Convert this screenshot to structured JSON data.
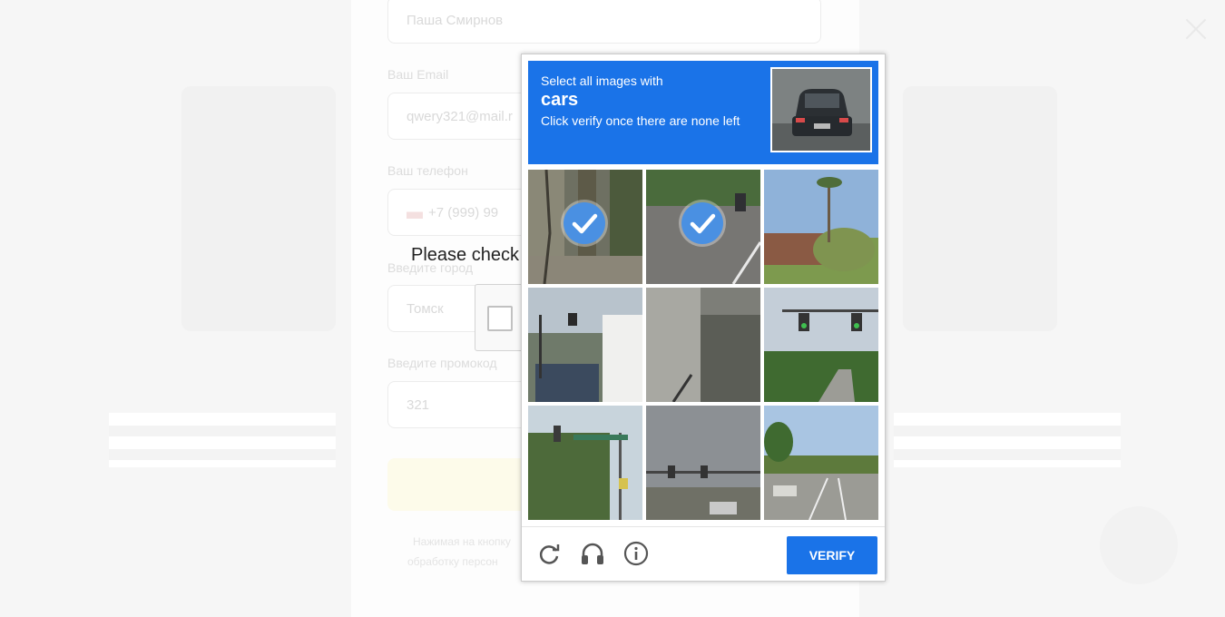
{
  "background_form": {
    "name_value": "Паша Смирнов",
    "email_label": "Ваш Email",
    "email_value": "qwery321@mail.r",
    "phone_label": "Ваш телефон",
    "phone_value": "+7 (999) 99",
    "city_label": "Введите город",
    "city_value": "Томск",
    "promo_label": "Введите промокод",
    "promo_value": "321",
    "note_line1": "Нажимая на кнопку",
    "note_line2": "обработку персон"
  },
  "recaptcha_anchor": {
    "prompt": "Please check"
  },
  "challenge": {
    "instruction_line1": "Select all images with",
    "target_word": "cars",
    "instruction_line3": "Click verify once there are none left",
    "tiles": [
      {
        "label": "tile-1",
        "selected": true
      },
      {
        "label": "tile-2",
        "selected": true
      },
      {
        "label": "tile-3",
        "selected": false
      },
      {
        "label": "tile-4",
        "selected": false
      },
      {
        "label": "tile-5",
        "selected": false
      },
      {
        "label": "tile-6",
        "selected": false
      },
      {
        "label": "tile-7",
        "selected": false
      },
      {
        "label": "tile-8",
        "selected": false
      },
      {
        "label": "tile-9",
        "selected": false
      }
    ],
    "footer_icons": [
      "reload-icon",
      "headphones-icon",
      "info-icon"
    ],
    "verify_label": "VERIFY"
  },
  "colors": {
    "header_blue": "#1a73e8",
    "check_blue": "#4a90e2"
  }
}
